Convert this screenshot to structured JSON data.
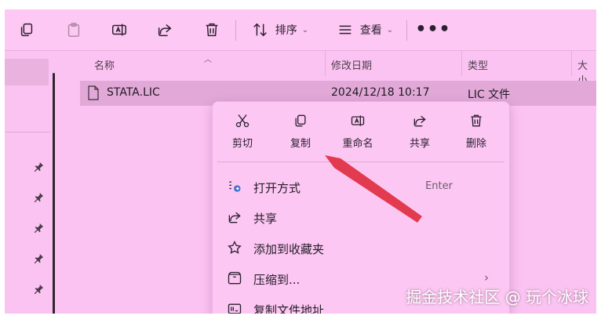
{
  "toolbar": {
    "sort_label": "排序",
    "view_label": "查看",
    "more_label": "•••"
  },
  "columns": {
    "name": "名称",
    "modified": "修改日期",
    "type": "类型",
    "size": "大小"
  },
  "file": {
    "name": "STATA.LIC",
    "modified": "2024/12/18 10:17",
    "type": "LIC 文件"
  },
  "context_menu": {
    "quick_actions": [
      {
        "label": "剪切",
        "icon": "scissors-icon"
      },
      {
        "label": "复制",
        "icon": "copy-icon"
      },
      {
        "label": "重命名",
        "icon": "rename-icon"
      },
      {
        "label": "共享",
        "icon": "share-icon"
      },
      {
        "label": "删除",
        "icon": "trash-icon"
      }
    ],
    "items": [
      {
        "label": "打开方式",
        "shortcut": "Enter",
        "icon": "open-with-icon"
      },
      {
        "label": "共享",
        "icon": "share-icon"
      },
      {
        "label": "添加到收藏夹",
        "icon": "star-icon"
      },
      {
        "label": "压缩到...",
        "chevron": "›",
        "icon": "archive-icon"
      },
      {
        "label": "复制文件地址",
        "icon": "copy-path-icon"
      }
    ]
  },
  "watermarks": {
    "corner": "掘金技术社区 @ 玩个冰球"
  },
  "colors": {
    "overlay": "#fbc3f1",
    "arrow": "#e23a4e"
  }
}
